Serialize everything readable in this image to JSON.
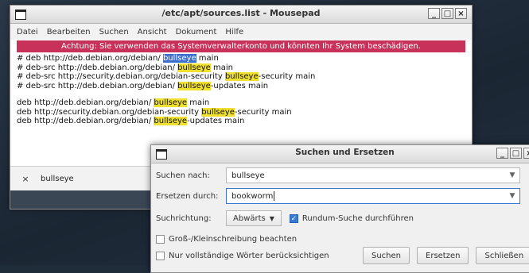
{
  "mousepad": {
    "title": "/etc/apt/sources.list - Mousepad",
    "menu": [
      "Datei",
      "Bearbeiten",
      "Suchen",
      "Ansicht",
      "Dokument",
      "Hilfe"
    ],
    "warning": "Achtung: Sie verwenden das Systemverwalterkonto und könnten Ihr System beschädigen.",
    "lines": [
      [
        "# deb http://deb.debian.org/debian/ ",
        "bullseye",
        " main"
      ],
      [
        "# deb-src http://deb.debian.org/debian/ ",
        "bullseye",
        " main"
      ],
      [
        "# deb-src http://security.debian.org/debian-security ",
        "bullseye",
        "-security main"
      ],
      [
        "# deb-src http://deb.debian.org/debian/ ",
        "bullseye",
        "-updates main"
      ],
      [
        "deb http://deb.debian.org/debian/ ",
        "bullseye",
        " main"
      ],
      [
        "deb http://security.debian.org/debian-security ",
        "bullseye",
        "-security main"
      ],
      [
        "deb http://deb.debian.org/debian/ ",
        "bullseye",
        "-updates main"
      ]
    ],
    "find_bar": {
      "close": "×",
      "value": "bullseye"
    }
  },
  "dialog": {
    "title": "Suchen und Ersetzen",
    "search_label": "Suchen nach:",
    "search_value": "bullseye",
    "replace_label": "Ersetzen durch:",
    "replace_value": "bookworm",
    "direction_label": "Suchrichtung:",
    "direction_value": "Abwärts",
    "wrap_label": "Rundum-Suche durchführen",
    "case_label": "Groß-/Kleinschreibung beachten",
    "whole_label": "Nur vollständige Wörter berücksichtigen",
    "buttons": {
      "search": "Suchen",
      "replace": "Ersetzen",
      "close": "Schließen"
    }
  }
}
